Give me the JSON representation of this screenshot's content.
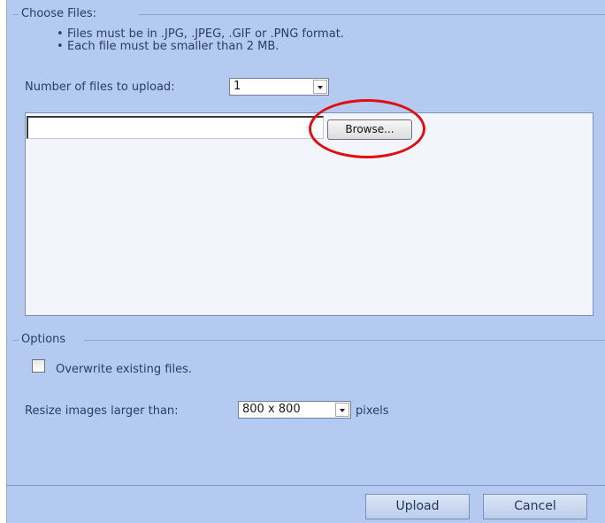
{
  "choose_files": {
    "legend": "Choose Files:",
    "rules": [
      "Files must be in .JPG, .JPEG, .GIF or .PNG format.",
      "Each file must be smaller than 2 MB."
    ],
    "num_files_label": "Number of files to upload:",
    "num_files_value": "1",
    "file_input_value": "",
    "browse_label": "Browse..."
  },
  "options": {
    "legend": "Options",
    "overwrite_label": "Overwrite existing files.",
    "overwrite_checked": false,
    "resize_label": "Resize images larger than:",
    "resize_value": "800 x 800",
    "resize_suffix": "pixels"
  },
  "footer": {
    "upload_label": "Upload",
    "cancel_label": "Cancel"
  },
  "annotation": {
    "highlight_color": "#e01010"
  }
}
